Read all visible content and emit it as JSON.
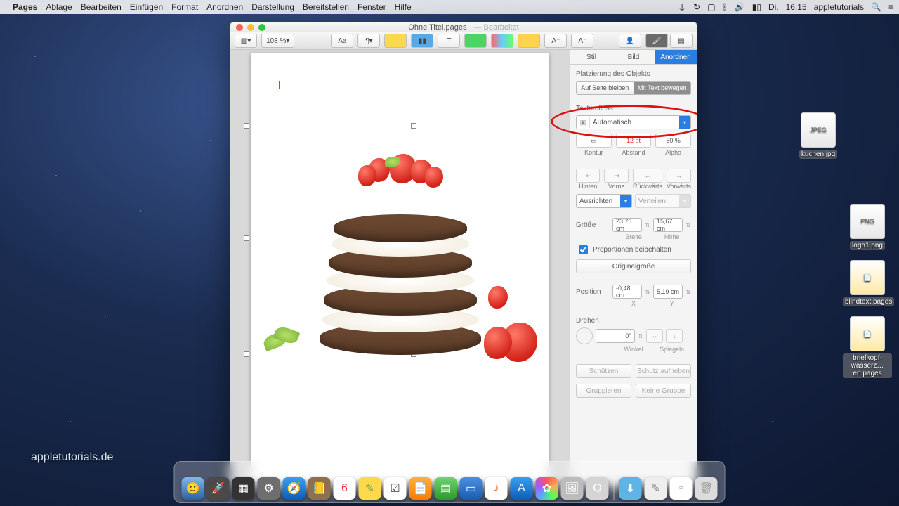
{
  "menubar": {
    "app": "Pages",
    "items": [
      "Ablage",
      "Bearbeiten",
      "Einfügen",
      "Format",
      "Anordnen",
      "Darstellung",
      "Bereitstellen",
      "Fenster",
      "Hilfe"
    ],
    "right": {
      "day": "Di.",
      "time": "16:15",
      "user": "appletutorials"
    }
  },
  "window": {
    "title": "Ohne Titel.pages",
    "edited": "Bearbeitet",
    "zoom": "108 %"
  },
  "inspector": {
    "tabs": [
      "Stil",
      "Bild",
      "Anordnen"
    ],
    "placement_title": "Platzierung des Objekts",
    "placement_opts": [
      "Auf Seite bleiben",
      "Mit Text bewegen"
    ],
    "wrap_title": "Textumfluss",
    "wrap_value": "Automatisch",
    "wrap_row": {
      "kontur": "Kontur",
      "abstand": "Abstand",
      "abstand_val": "12 pt",
      "alpha": "Alpha",
      "alpha_val": "50 %"
    },
    "order": [
      "Hinten",
      "Vorne",
      "Rückwärts",
      "Vorwärts"
    ],
    "align_label": "Ausrichten",
    "distribute_label": "Verteilen",
    "size_label": "Größe",
    "width": "23,73 cm",
    "width_l": "Breite",
    "height": "15,67 cm",
    "height_l": "Höhe",
    "constrain": "Proportionen beibehalten",
    "orig": "Originalgröße",
    "pos_label": "Position",
    "x": "-0,48 cm",
    "x_l": "X",
    "y": "5,19 cm",
    "y_l": "Y",
    "rotate_label": "Drehen",
    "angle": "0°",
    "angle_l": "Winkel",
    "flip_l": "Spiegeln",
    "protect": "Schützen",
    "unprotect": "Schutz aufheben",
    "group": "Gruppieren",
    "ungroup": "Keine Gruppe"
  },
  "desktop": {
    "files": [
      "kuchen.jpg",
      "logo1.png",
      "blindtext.pages",
      "briefkopf-wasserz…en.pages"
    ]
  },
  "logo_text": "appletutorials.de"
}
